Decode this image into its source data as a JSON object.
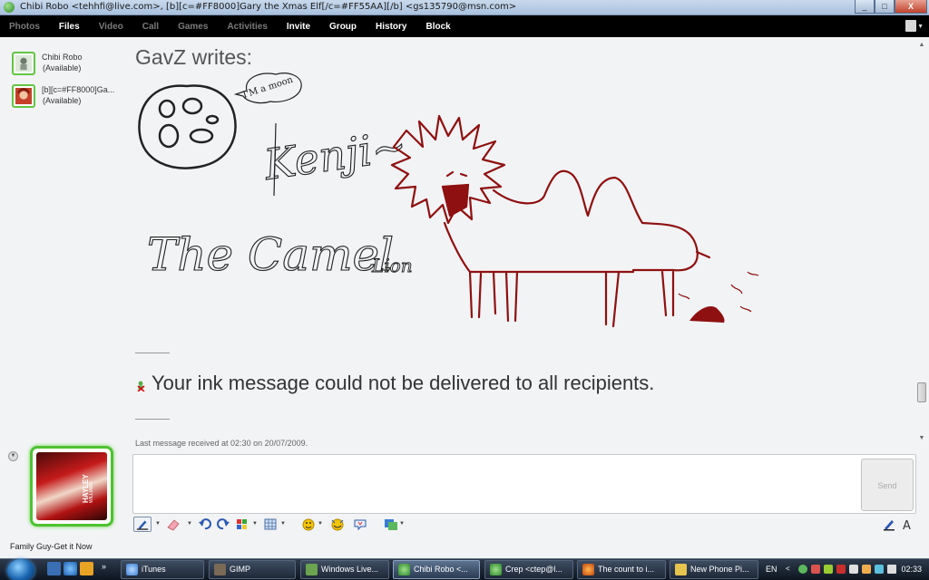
{
  "window": {
    "title": "Chibi Robo <tehhfi@live.com>, [b][c=#FF8000]Gary the Xmas Elf[/c=#FF55AA][/b] <gs135790@msn.com>",
    "controls": [
      "_",
      "□",
      "X"
    ]
  },
  "menu": [
    {
      "label": "Photos",
      "enabled": false
    },
    {
      "label": "Files",
      "enabled": true
    },
    {
      "label": "Video",
      "enabled": false
    },
    {
      "label": "Call",
      "enabled": false
    },
    {
      "label": "Games",
      "enabled": false
    },
    {
      "label": "Activities",
      "enabled": false
    },
    {
      "label": "Invite",
      "enabled": true
    },
    {
      "label": "Group",
      "enabled": true
    },
    {
      "label": "History",
      "enabled": true
    },
    {
      "label": "Block",
      "enabled": true
    }
  ],
  "contacts": [
    {
      "name": "Chibi Robo",
      "status": "(Available)"
    },
    {
      "name": "[b][c=#FF8000]Ga...",
      "status": "(Available)"
    }
  ],
  "conversation": {
    "writer": "GavZ writes:",
    "ink_words": [
      "I'M a moon",
      "Kenji~",
      "The Camel",
      "Lion"
    ],
    "error_message": "Your ink message could not be delivered to all recipients.",
    "last_message": "Last message received at 02:30 on 20/07/2009."
  },
  "my_picture_text": {
    "line1": "HAYLEY",
    "line2": "WILLIAMS"
  },
  "ad_text": "Family Guy-Get it Now",
  "send_label": "Send",
  "colors": {
    "ink_black": "#222222",
    "ink_red": "#8e1010",
    "frame_green": "#4fc232",
    "menubar": "#000000"
  },
  "taskbar": {
    "tasks": [
      {
        "label": "iTunes"
      },
      {
        "label": "GIMP"
      },
      {
        "label": "Windows Live..."
      },
      {
        "label": "Chibi Robo <..."
      },
      {
        "label": "Crep <ctep@l..."
      },
      {
        "label": "The count to i..."
      },
      {
        "label": "New Phone Pi..."
      }
    ],
    "language": "EN",
    "clock": "02:33"
  }
}
